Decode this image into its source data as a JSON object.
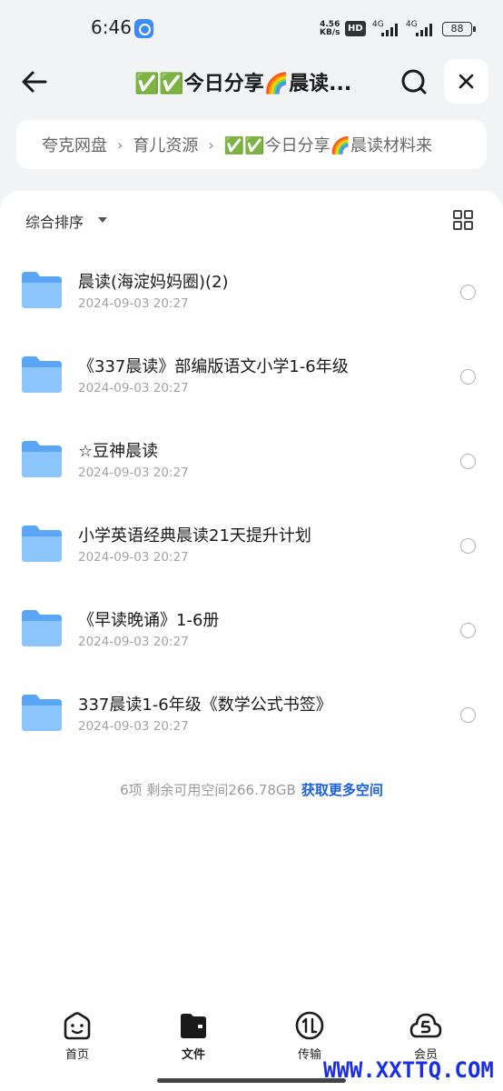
{
  "status_bar": {
    "time": "6:46",
    "net_speed_value": "4.56",
    "net_speed_unit": "KB/s",
    "hd_badge": "HD",
    "signal1_label": "4G",
    "signal2_label": "4G",
    "battery": "88"
  },
  "header": {
    "title": "✅✅今日分享🌈晨读...",
    "back_icon": "arrow-left-icon",
    "search_icon": "search-icon",
    "close_icon": "close-icon"
  },
  "breadcrumb": {
    "items": [
      "夸克网盘",
      "育儿资源",
      "✅✅今日分享🌈晨读材料来"
    ],
    "separator": "›"
  },
  "sort_bar": {
    "label": "综合排序",
    "grid_icon": "grid-view-icon"
  },
  "files": [
    {
      "name": "晨读(海淀妈妈圈)(2)",
      "date": "2024-09-03 20:27"
    },
    {
      "name": "《337晨读》部编版语文小学1-6年级",
      "date": "2024-09-03 20:27"
    },
    {
      "name": "☆豆神晨读",
      "date": "2024-09-03 20:27"
    },
    {
      "name": "小学英语经典晨读21天提升计划",
      "date": "2024-09-03 20:27"
    },
    {
      "name": "《早读晚诵》1-6册",
      "date": "2024-09-03 20:27"
    },
    {
      "name": "337晨读1-6年级《数学公式书签》",
      "date": "2024-09-03 20:27"
    }
  ],
  "footer": {
    "info": "6项 剩余可用空间266.78GB",
    "link": "获取更多空间"
  },
  "bottom_nav": [
    {
      "label": "首页",
      "icon": "home-icon"
    },
    {
      "label": "文件",
      "icon": "folder-icon"
    },
    {
      "label": "传输",
      "icon": "transfer-icon"
    },
    {
      "label": "会员",
      "icon": "membership-icon"
    }
  ],
  "watermark": "WWW.XXTTQ.COM",
  "colors": {
    "accent": "#1a5fe0",
    "folder": "#6fb1f7",
    "background": "#f2f3f5"
  }
}
